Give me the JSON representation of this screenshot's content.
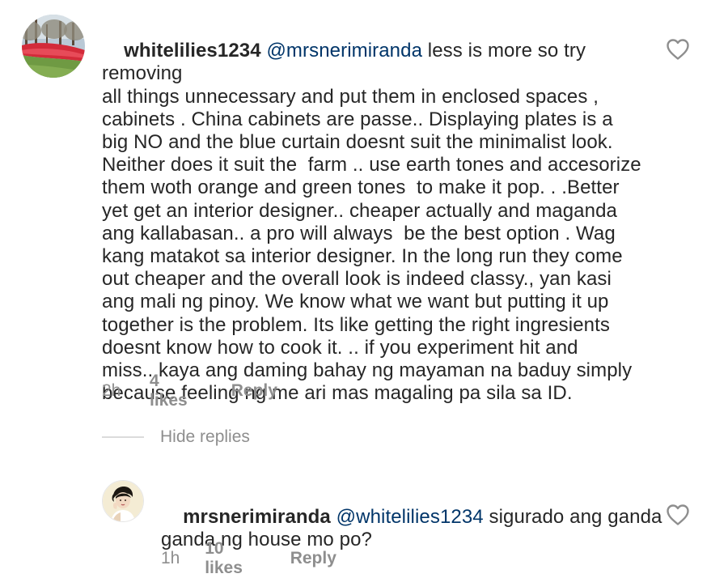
{
  "comments": [
    {
      "username": "whitelilies1234",
      "mention": "@mrsnerimiranda",
      "lines": [
        " less is more so try removing",
        "all things unnecessary and put them in enclosed spaces ,",
        "cabinets . China cabinets are passe.. Displaying plates is a",
        "big NO and the blue curtain doesnt suit the minimalist look.",
        "Neither does it suit the  farm .. use earth tones and accesorize",
        "them woth orange and green tones  to make it pop. . .Better",
        "yet get an interior designer.. cheaper actually and maganda",
        "ang kallabasan.. a pro will always  be the best option . Wag",
        "kang matakot sa interior designer. In the long run they come",
        "out cheaper and the overall look is indeed classy., yan kasi",
        "ang mali ng pinoy. We know what we want but putting it up",
        "together is the problem. Its like getting the right ingresients",
        "doesnt know how to cook it. .. if you experiment hit and",
        "miss.. kaya ang daming bahay ng mayaman na baduy simply",
        "because feeling ng me ari mas magaling pa sila sa ID."
      ],
      "time": "2h",
      "likes": "4 likes",
      "reply": "Reply",
      "like_icon": "heart-outline-icon"
    },
    {
      "username": "mrsnerimiranda",
      "mention": "@whitelilies1234",
      "lines": [
        " sigurado ang ganda",
        "ganda ng house mo po?"
      ],
      "time": "1h",
      "likes": "10 likes",
      "reply": "Reply",
      "like_icon": "heart-outline-icon"
    }
  ],
  "hide_replies": "Hide replies",
  "colors": {
    "text": "#262626",
    "mention": "#003569",
    "muted": "#8e8e8e",
    "divider": "#dbdbdb"
  }
}
